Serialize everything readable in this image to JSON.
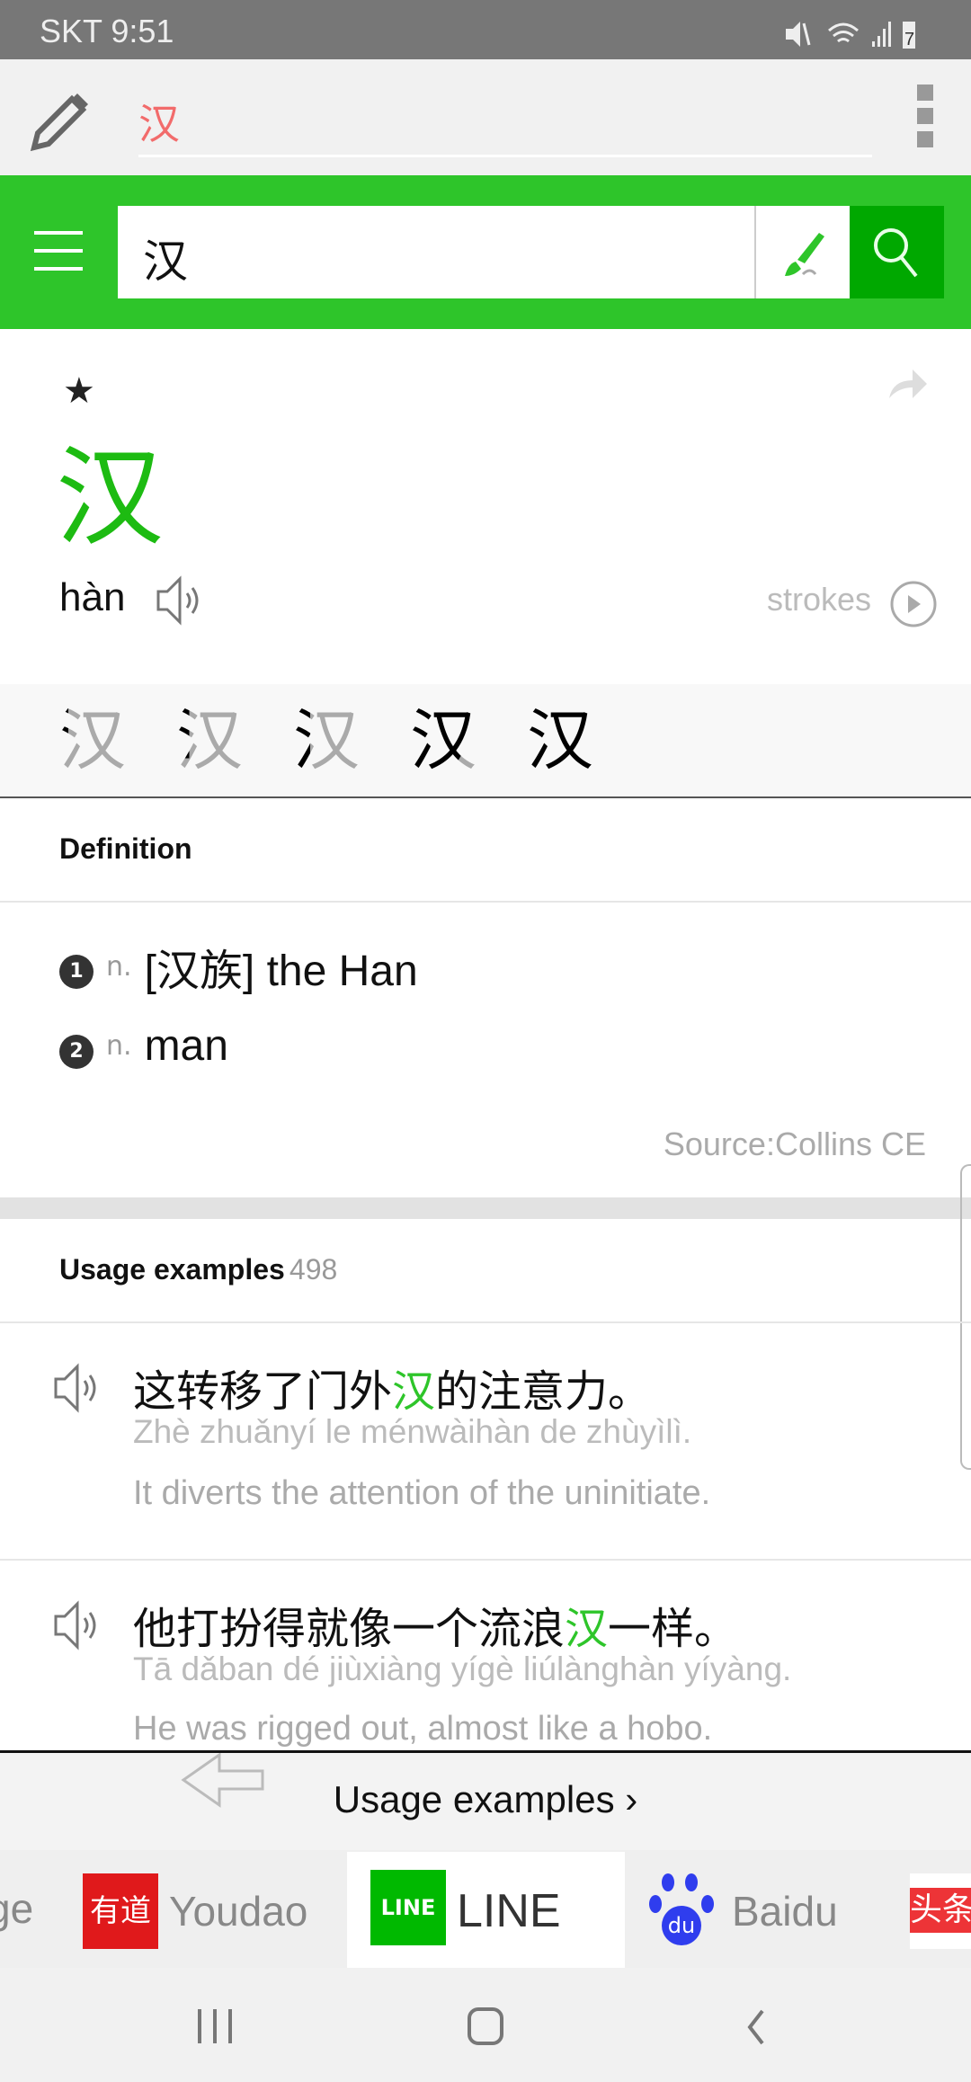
{
  "status_bar": {
    "carrier_time": "SKT 9:51",
    "battery": "7",
    "icons": [
      "mute-icon",
      "wifi-icon",
      "signal-icon",
      "battery-charging-icon"
    ]
  },
  "toolbar": {
    "handwriting_value": "汉",
    "icons": [
      "pencil-icon",
      "more-vert-icon"
    ]
  },
  "search": {
    "value": "汉",
    "icons": [
      "menu-icon",
      "brush-icon",
      "search-icon"
    ]
  },
  "entry": {
    "character": "汉",
    "pinyin": "hàn",
    "strokes_label": "strokes",
    "stroke_steps": 5,
    "icons": [
      "star-icon",
      "share-icon",
      "speaker-icon",
      "play-icon"
    ]
  },
  "definition": {
    "header": "Definition",
    "items": [
      {
        "num": "1",
        "pos": "n.",
        "text": "[汉族] the Han"
      },
      {
        "num": "2",
        "pos": "n.",
        "text": "man"
      }
    ],
    "source": "Source:Collins CE"
  },
  "usage": {
    "header": "Usage examples",
    "count": "498",
    "examples": [
      {
        "cn_before": "这转移了门外",
        "cn_hl": "汉",
        "cn_after": "的注意力。",
        "pinyin": "Zhè zhuǎnyí le ménwàihàn de zhùyìlì.",
        "en": "It diverts the attention of the uninitiate."
      },
      {
        "cn_before": "他打扮得就像一个流浪",
        "cn_hl": "汉",
        "cn_after": "一样。",
        "pinyin": "Tā dǎban dé jiùxiàng yígè liúlànghàn yíyàng.",
        "en": "He was rigged out, almost like a hobo."
      }
    ]
  },
  "bottom": {
    "link": "Usage examples ›"
  },
  "dict_tabs": [
    {
      "label": "ge"
    },
    {
      "label": "Youdao",
      "logo": "有道"
    },
    {
      "label": "LINE",
      "logo": "LINE",
      "active": true
    },
    {
      "label": "Baidu",
      "logo": "du"
    },
    {
      "label": "",
      "logo": "头条"
    }
  ],
  "colors": {
    "accent": "#2ec52a",
    "search_button": "#00a800",
    "handwriting_text": "#f26b6b"
  }
}
